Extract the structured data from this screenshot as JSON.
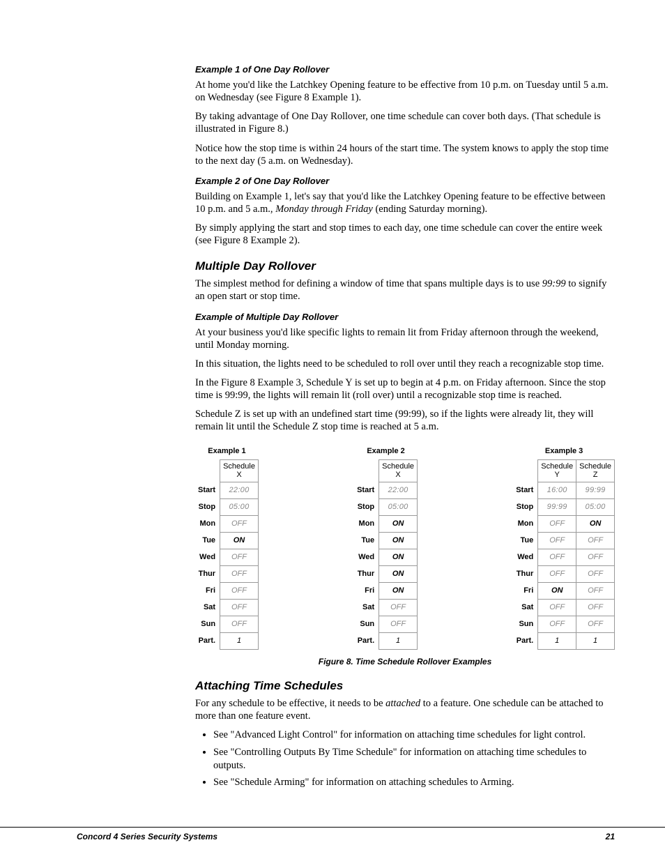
{
  "headings": {
    "ex1": "Example 1 of One Day Rollover",
    "ex2": "Example 2 of One Day Rollover",
    "multi": "Multiple Day Rollover",
    "exMulti": "Example of Multiple Day Rollover",
    "attach": "Attaching Time Schedules"
  },
  "paragraphs": {
    "p1": "At home you'd like the Latchkey Opening feature to be effective from 10 p.m. on Tuesday until 5 a.m. on Wednesday (see Figure 8 Example 1).",
    "p2": "By taking advantage of One Day Rollover, one time schedule can cover both days. (That schedule is illustrated in Figure 8.)",
    "p3": "Notice how the stop time is within 24 hours of the start time. The system knows to apply the stop time to the next day (5 a.m. on Wednesday).",
    "p4a": "Building on Example 1, let's say that you'd like the Latchkey Opening feature to be effective between 10 p.m. and 5 a.m., ",
    "p4b": "Monday through Friday",
    "p4c": " (ending Saturday morning).",
    "p5": "By simply applying the start and stop times to each day, one time schedule can cover the entire week (see Figure 8 Example 2).",
    "p6a": "The simplest method for defining a window of time that spans multiple days is to use ",
    "p6b": "99:99",
    "p6c": " to signify an open start or stop time.",
    "p7": "At your business you'd like specific lights to remain lit from Friday afternoon through the weekend, until Monday morning.",
    "p8": "In this situation, the lights need to be scheduled to roll over until they reach a recognizable stop time.",
    "p9": "In the Figure 8 Example 3, Schedule Y is set up to begin at 4 p.m. on Friday afternoon. Since the stop time is 99:99, the lights will remain lit (roll over) until a recognizable stop time is reached.",
    "p10": "Schedule Z is set up with an undefined start time (99:99), so if the lights were already lit, they will remain lit until the Schedule Z stop time is reached at 5 a.m.",
    "attach1a": "For any schedule to be effective, it needs to be ",
    "attach1b": "attached",
    "attach1c": " to a feature. One schedule can be attached to more than one feature event."
  },
  "bullets": {
    "b1": "See \"Advanced Light Control\" for information on attaching time schedules for light control.",
    "b2": "See \"Controlling Outputs By Time Schedule\" for information on attaching time schedules to outputs.",
    "b3": "See \"Schedule Arming\" for information on attaching schedules to Arming."
  },
  "figureCaption": "Figure 8. Time Schedule Rollover Examples",
  "footer": {
    "left": "Concord  4 Series Security Systems",
    "right": "21"
  },
  "rowLabels": [
    "Start",
    "Stop",
    "Mon",
    "Tue",
    "Wed",
    "Thur",
    "Fri",
    "Sat",
    "Sun",
    "Part."
  ],
  "examples": {
    "e1": {
      "title": "Example 1",
      "cols": [
        {
          "head": "Schedule\nX",
          "values": [
            "22:00",
            "05:00",
            "OFF",
            "ON",
            "OFF",
            "OFF",
            "OFF",
            "OFF",
            "OFF",
            "1"
          ]
        }
      ]
    },
    "e2": {
      "title": "Example 2",
      "cols": [
        {
          "head": "Schedule\nX",
          "values": [
            "22:00",
            "05:00",
            "ON",
            "ON",
            "ON",
            "ON",
            "ON",
            "OFF",
            "OFF",
            "1"
          ]
        }
      ]
    },
    "e3": {
      "title": "Example 3",
      "cols": [
        {
          "head": "Schedule\nY",
          "values": [
            "16:00",
            "99:99",
            "OFF",
            "OFF",
            "OFF",
            "OFF",
            "ON",
            "OFF",
            "OFF",
            "1"
          ]
        },
        {
          "head": "Schedule\nZ",
          "values": [
            "99:99",
            "05:00",
            "ON",
            "OFF",
            "OFF",
            "OFF",
            "OFF",
            "OFF",
            "OFF",
            "1"
          ]
        }
      ]
    }
  }
}
